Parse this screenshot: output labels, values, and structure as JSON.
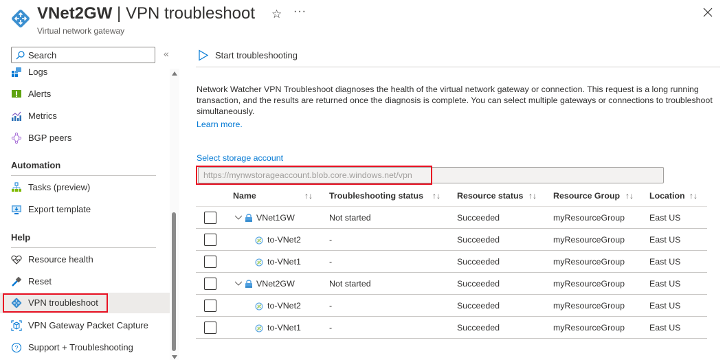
{
  "header": {
    "resource_name": "VNet2GW",
    "separator": " | ",
    "page_title": "VPN troubleshoot",
    "subtitle": "Virtual network gateway",
    "favorite_icon": "star-outline-icon",
    "more_icon": "ellipsis-icon",
    "more_label": "···",
    "close_icon": "close-icon"
  },
  "sidebar": {
    "search_placeholder": "Search",
    "collapse_label": "«",
    "items_top": [
      {
        "label": "Logs",
        "icon": "logs-icon"
      },
      {
        "label": "Alerts",
        "icon": "alerts-icon"
      },
      {
        "label": "Metrics",
        "icon": "metrics-icon"
      },
      {
        "label": "BGP peers",
        "icon": "bgp-peers-icon"
      }
    ],
    "sections": [
      {
        "title": "Automation",
        "items": [
          {
            "label": "Tasks (preview)",
            "icon": "tasks-icon"
          },
          {
            "label": "Export template",
            "icon": "export-template-icon"
          }
        ]
      },
      {
        "title": "Help",
        "items": [
          {
            "label": "Resource health",
            "icon": "heart-icon"
          },
          {
            "label": "Reset",
            "icon": "hammer-icon"
          },
          {
            "label": "VPN troubleshoot",
            "icon": "vpn-gateway-icon",
            "selected": true
          },
          {
            "label": "VPN Gateway Packet Capture",
            "icon": "packet-capture-icon"
          },
          {
            "label": "Support + Troubleshooting",
            "icon": "question-icon"
          }
        ]
      }
    ]
  },
  "main": {
    "toolbar": {
      "start_label": "Start troubleshooting",
      "start_icon": "play-icon"
    },
    "description": "Network Watcher VPN Troubleshoot diagnoses the health of the virtual network gateway or connection. This request is a long running transaction, and the results are returned once the diagnosis is complete. You can select multiple gateways or connections to troubleshoot simultaneously.",
    "learn_more": "Learn more.",
    "storage": {
      "label": "Select storage account",
      "value": "https://mynwstorageaccount.blob.core.windows.net/vpn"
    },
    "table": {
      "columns": [
        "Name",
        "Troubleshooting status",
        "Resource status",
        "Resource Group",
        "Location"
      ],
      "sort_icon": "↑↓",
      "rows": [
        {
          "name": "VNet1GW",
          "type": "gateway",
          "troubleshooting_status": "Not started",
          "resource_status": "Succeeded",
          "resource_group": "myResourceGroup",
          "location": "East US",
          "checked": false
        },
        {
          "name": "to-VNet2",
          "type": "connection",
          "troubleshooting_status": "-",
          "resource_status": "Succeeded",
          "resource_group": "myResourceGroup",
          "location": "East US",
          "checked": false
        },
        {
          "name": "to-VNet1",
          "type": "connection",
          "troubleshooting_status": "-",
          "resource_status": "Succeeded",
          "resource_group": "myResourceGroup",
          "location": "East US",
          "checked": false
        },
        {
          "name": "VNet2GW",
          "type": "gateway",
          "troubleshooting_status": "Not started",
          "resource_status": "Succeeded",
          "resource_group": "myResourceGroup",
          "location": "East US",
          "checked": false
        },
        {
          "name": "to-VNet2",
          "type": "connection",
          "troubleshooting_status": "-",
          "resource_status": "Succeeded",
          "resource_group": "myResourceGroup",
          "location": "East US",
          "checked": false
        },
        {
          "name": "to-VNet1",
          "type": "connection",
          "troubleshooting_status": "-",
          "resource_status": "Succeeded",
          "resource_group": "myResourceGroup",
          "location": "East US",
          "checked": false
        }
      ]
    }
  },
  "colors": {
    "accent": "#0078d4",
    "highlight_box": "#e81123",
    "selected_bg": "#edebe9"
  }
}
